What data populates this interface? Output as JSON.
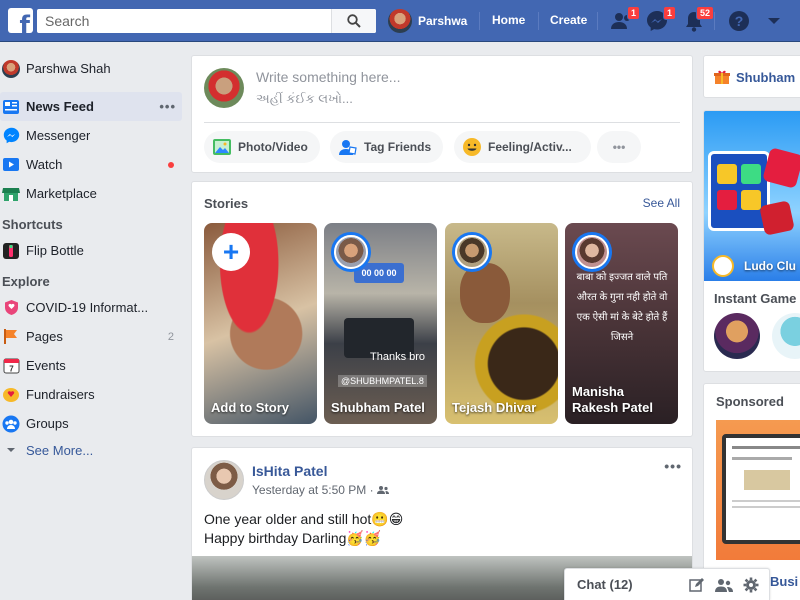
{
  "topbar": {
    "search_placeholder": "Search",
    "user_name": "Parshwa",
    "home": "Home",
    "create": "Create",
    "friend_requests_badge": "1",
    "messages_badge": "1",
    "notifications_badge": "52"
  },
  "sidebar": {
    "profile_name": "Parshwa Shah",
    "items": [
      {
        "label": "News Feed",
        "icon": "news-feed-icon"
      },
      {
        "label": "Messenger",
        "icon": "messenger-icon"
      },
      {
        "label": "Watch",
        "icon": "watch-icon"
      },
      {
        "label": "Marketplace",
        "icon": "marketplace-icon"
      }
    ],
    "more_dots": "•••",
    "shortcuts_heading": "Shortcuts",
    "shortcuts": [
      {
        "label": "Flip Bottle",
        "icon": "flip-bottle-icon"
      }
    ],
    "explore_heading": "Explore",
    "explore": [
      {
        "label": "COVID-19 Informat...",
        "icon": "covid-icon"
      },
      {
        "label": "Pages",
        "count": "2",
        "icon": "pages-icon"
      },
      {
        "label": "Events",
        "icon": "events-icon"
      },
      {
        "label": "Fundraisers",
        "icon": "fundraisers-icon"
      },
      {
        "label": "Groups",
        "icon": "groups-icon"
      }
    ],
    "see_more": "See More..."
  },
  "composer": {
    "placeholder_en": "Write something here...",
    "placeholder_gu": "અહીં કંઈક લખો...",
    "buttons": [
      "Photo/Video",
      "Tag Friends",
      "Feeling/Activ..."
    ],
    "more_dots": "•••"
  },
  "stories": {
    "title": "Stories",
    "see_all": "See All",
    "items": [
      {
        "name": "Add to Story"
      },
      {
        "name": "Shubham Patel",
        "overlay_text": "Thanks bro",
        "handle": "@SHUBHMPATEL.8"
      },
      {
        "name": "Tejash Dhivar"
      },
      {
        "name": "Manisha Rakesh Patel",
        "overlay_text": "बाबा को इज्जत वाले पति औरत के गुना नही होते वो एक ऐसी मां के बेटे होते हैं जिसने"
      }
    ]
  },
  "post": {
    "author": "IsHita Patel",
    "time": "Yesterday at 5:50 PM · ",
    "more_dots": "•••",
    "line1": "One year older and still hot😬😁",
    "line2": "Happy birthday Darling🥳🥳"
  },
  "right": {
    "card1_name": "Shubham",
    "ludo_label": "Ludo Clu",
    "instant_games": "Instant Game",
    "sponsored": "Sponsored",
    "busi": "Busi"
  },
  "chat": {
    "label": "Chat (12)"
  }
}
